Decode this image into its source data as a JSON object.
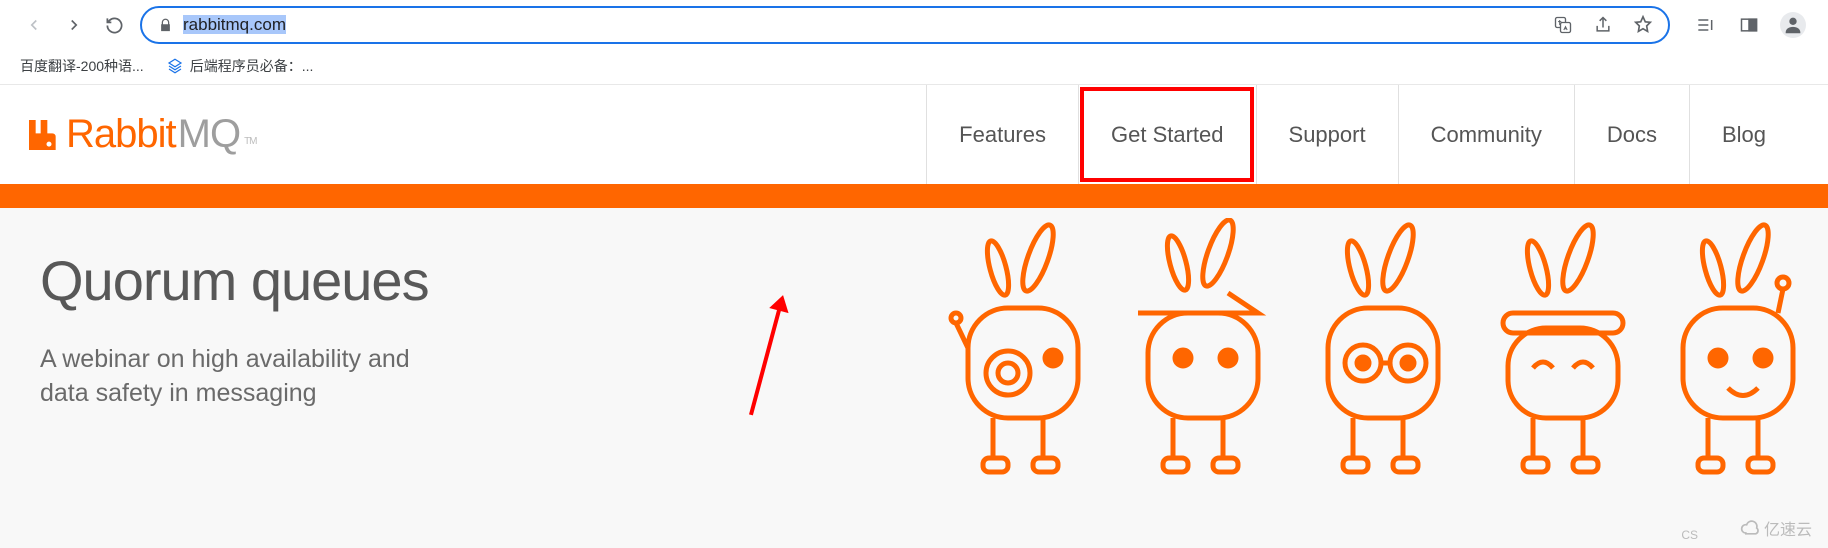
{
  "browser": {
    "url_display": "rabbitmq.com",
    "bookmarks": [
      {
        "label": "百度翻译-200种语..."
      },
      {
        "label": "后端程序员必备：..."
      }
    ]
  },
  "site": {
    "logo": {
      "brand": "Rabbit",
      "suffix": "MQ",
      "tm": "TM"
    },
    "nav": [
      {
        "label": "Features",
        "highlight": false
      },
      {
        "label": "Get Started",
        "highlight": true
      },
      {
        "label": "Support",
        "highlight": false
      },
      {
        "label": "Community",
        "highlight": false
      },
      {
        "label": "Docs",
        "highlight": false
      },
      {
        "label": "Blog",
        "highlight": false
      }
    ]
  },
  "hero": {
    "title": "Quorum queues",
    "subtitle": "A webinar on high availability and data safety in messaging"
  },
  "watermark": {
    "text": "亿速云",
    "cs": "CS"
  },
  "colors": {
    "accent": "#ff6600",
    "highlight": "#ff0000"
  }
}
